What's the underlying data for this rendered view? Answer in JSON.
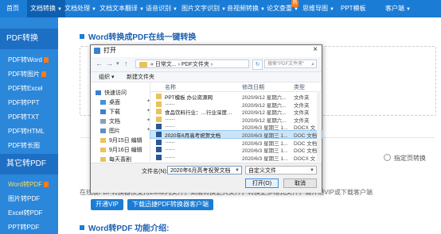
{
  "nav": {
    "items": [
      {
        "label": "首页",
        "caret": false
      },
      {
        "label": "文档转换",
        "caret": true,
        "active": true
      },
      {
        "label": "文档处理",
        "caret": true
      },
      {
        "label": "文档文本翻译",
        "caret": true
      },
      {
        "label": "语音识别",
        "caret": true
      },
      {
        "label": "图片文字识别",
        "caret": true
      },
      {
        "label": "音视频转换",
        "caret": true
      },
      {
        "label": "论文查重",
        "caret": true
      },
      {
        "label": "思维导图",
        "caret": true
      },
      {
        "label": "PPT模板",
        "caret": false
      },
      {
        "label": "客户端",
        "caret": true
      }
    ],
    "hot_badge": "热"
  },
  "sidebar": {
    "group1_title": "PDF转换",
    "group1_items": [
      "PDF转Word",
      "PDF转图片",
      "PDF转Excel",
      "PDF转PPT",
      "PDF转TXT",
      "PDF转HTML",
      "PDF转长图"
    ],
    "group2_title": "其它转PDF",
    "group2_items": [
      "Word转PDF",
      "图片转PDF",
      "Excel转PDF",
      "PPT转PDF"
    ]
  },
  "main": {
    "title": "Word转换成PDF在线一键转换",
    "radio_option": "指定页转换",
    "note": "在线版PDF转换器仅支持2M以内文件，如需转换更大文件，转换更多格式文件，请开通VIP或下载客户端",
    "btn_vip": "开通VIP",
    "btn_download": "下载迅捷PDF转换器客户端",
    "section2_title": "Word转PDF 功能介绍:"
  },
  "dialog": {
    "title": "打开",
    "close": "×",
    "breadcrumb": "« 日常文... › PDF文件夹 ›",
    "search_placeholder": "搜索\"PDF文件夹\"",
    "toolbar_organize": "组织 ▾",
    "toolbar_new_folder": "新建文件夹",
    "nav_items": [
      {
        "label": "快速访问",
        "icon": "star-icon",
        "color": "#3a7fd1"
      },
      {
        "label": "桌面",
        "icon": "desktop-icon",
        "color": "#4a90d9"
      },
      {
        "label": "下载",
        "icon": "download-icon",
        "color": "#3a7fd1"
      },
      {
        "label": "文档",
        "icon": "document-icon",
        "color": "#8aa0b8"
      },
      {
        "label": "图片",
        "icon": "picture-icon",
        "color": "#5a8fc8"
      },
      {
        "label": "9月15日 编辑",
        "icon": "folder-icon",
        "color": "#e8c25c"
      },
      {
        "label": "9月16日 编辑",
        "icon": "folder-icon",
        "color": "#e8c25c"
      },
      {
        "label": "每天喜剧",
        "icon": "folder-icon",
        "color": "#e8c25c"
      }
    ],
    "columns": {
      "name": "名称",
      "date": "修改日期",
      "type": "类型"
    },
    "files": [
      {
        "name": "PPT模板 办公资源网",
        "date": "2020/9/12 星期六...",
        "type": "文件夹",
        "icon": "folder-icon",
        "color": "#e8c25c",
        "selected": false
      },
      {
        "name": "……",
        "date": "2020/9/12 星期六...",
        "type": "文件夹",
        "icon": "folder-icon",
        "color": "#e8c25c",
        "selected": false
      },
      {
        "name": "食品饮料行业：…行业深度…",
        "date": "2020/9/12 星期六...",
        "type": "文件夹",
        "icon": "folder-icon",
        "color": "#e8c25c",
        "selected": false
      },
      {
        "name": "……",
        "date": "2020/9/12 星期六...",
        "type": "文件夹",
        "icon": "folder-icon",
        "color": "#e8c25c",
        "selected": false
      },
      {
        "name": "……",
        "date": "2020/6/3 星期三 1...",
        "type": "DOCX 文",
        "icon": "word-icon",
        "color": "#2b5797",
        "selected": false
      },
      {
        "name": "2020年6月高考祝贺文档",
        "date": "2020/6/3 星期三 1...",
        "type": "DOC 文档",
        "icon": "word-icon",
        "color": "#2b5797",
        "selected": true
      },
      {
        "name": "……",
        "date": "2020/6/3 星期三 1...",
        "type": "DOC 文档",
        "icon": "word-icon",
        "color": "#2b5797",
        "selected": false
      },
      {
        "name": "……",
        "date": "2020/6/3 星期三 1...",
        "type": "DOC 文档",
        "icon": "word-icon",
        "color": "#2b5797",
        "selected": false
      },
      {
        "name": "……",
        "date": "2020/6/3 星期三 1...",
        "type": "DOCX 文",
        "icon": "word-icon",
        "color": "#2b5797",
        "selected": false
      }
    ],
    "filename_label": "文件名(N):",
    "filename_value": "2020年6月高考祝贺文档",
    "filetype_value": "自定义文件",
    "open_button": "打开(O)",
    "cancel_button": "取消"
  },
  "colors": {
    "brand": "#1b7cd6",
    "sidebar": "#2b87da",
    "sidebar_active": "#ffd75c",
    "hot": "#ff7a1a"
  }
}
